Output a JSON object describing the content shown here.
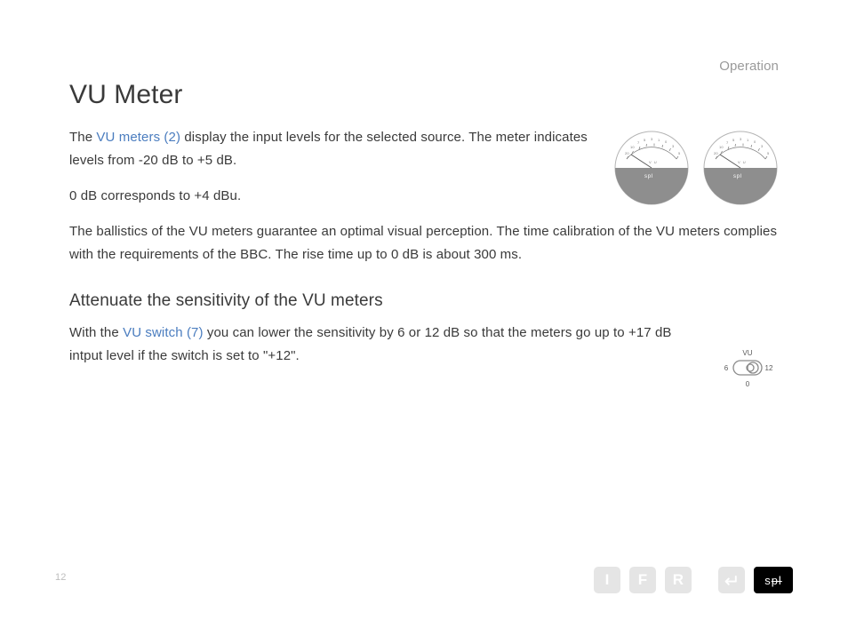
{
  "section_label": "Operation",
  "h1": "VU Meter",
  "p1_a": "The ",
  "p1_link": "VU meters (2)",
  "p1_b": " display the input levels for the selected source. The meter indicates levels from -20 dB to +5 dB.",
  "p2": "0 dB corresponds to +4 dBu.",
  "p3": "The ballistics of the VU meters guarantee an optimal visual perception. The time calibration of the VU meters complies with the requirements of the BBC. The rise time up to 0 dB is about 300 ms.",
  "h2": "Attenuate the sensitivity of the VU meters",
  "p4_a": "With the ",
  "p4_link": "VU switch (7)",
  "p4_b": " you can lower the sensitivity by 6 or 12 dB so that the meters go up to +17 dB intput level if the switch is set to \"+12\".",
  "page_number": "12",
  "footer": {
    "i": "I",
    "f": "F",
    "r": "R",
    "spl": "spl"
  },
  "switch_labels": {
    "top": "VU",
    "left": "6",
    "right": "12",
    "bottom": "0"
  }
}
